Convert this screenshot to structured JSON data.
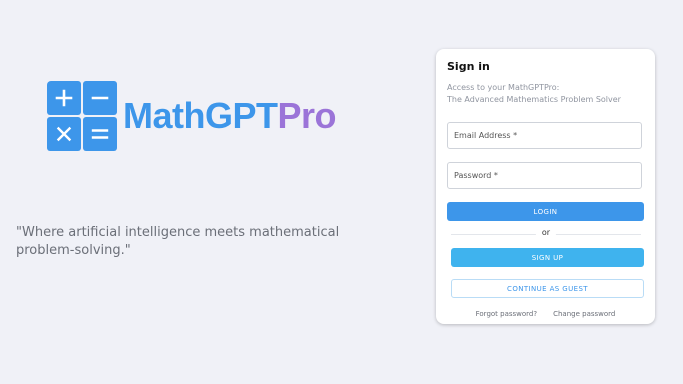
{
  "logo": {
    "text_math": "MathGPT",
    "text_pro": "Pro",
    "tiles": [
      "plus-icon",
      "minus-icon",
      "times-icon",
      "equals-icon"
    ],
    "color_primary": "#3d96ea",
    "color_accent": "#9b74d8"
  },
  "quote": "\"Where artificial intelligence meets mathematical problem-solving.\"",
  "signin": {
    "title": "Sign in",
    "subtitle_line1": "Access to your MathGPTPro:",
    "subtitle_line2": "The Advanced Mathematics Problem Solver",
    "email_placeholder": "Email Address *",
    "password_placeholder": "Password *",
    "login_label": "LOGIN",
    "or_label": "or",
    "signup_label": "SIGN UP",
    "guest_label": "CONTINUE AS GUEST",
    "forgot_label": "Forgot password?",
    "change_label": "Change password"
  }
}
